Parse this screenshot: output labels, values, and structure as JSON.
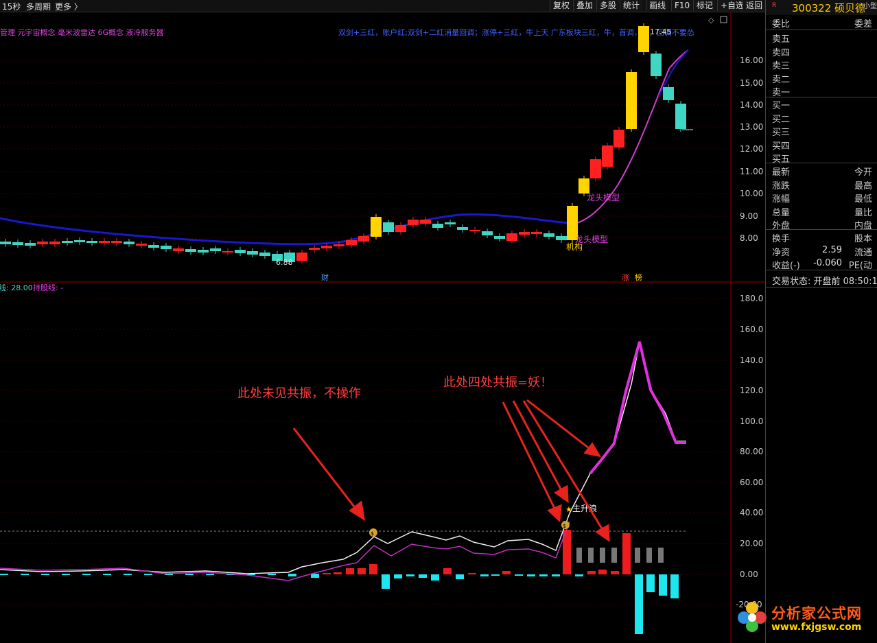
{
  "topbar": {
    "period": "15秒",
    "multi": "多周期",
    "more": "更多 〉",
    "buttons": [
      "复权",
      "叠加",
      "多股",
      "统计",
      "画线",
      "F10",
      "标记",
      "+自选",
      "返回"
    ]
  },
  "concepts": {
    "left": "管理 元宇宙概念 毫米波雷达 6G概念 液冷服务器",
    "right": "双剑+三红，账户红;双剑+二红消量回调；涨停+三红，牛上天 广东板块三红，牛，首调，红，回调不要怂"
  },
  "main_axis": [
    "16.00",
    "15.00",
    "14.00",
    "13.00",
    "12.00",
    "11.00",
    "10.00",
    "9.00",
    "8.00"
  ],
  "sub_axis": [
    "180.0",
    "160.0",
    "140.0",
    "120.0",
    "100.0",
    "80.00",
    "60.00",
    "40.00",
    "20.00",
    "0.00",
    "-20.00"
  ],
  "labels": {
    "high": "17.45",
    "low": "6.88",
    "dragon1": "龙头模型",
    "dragon2": "龙头模型",
    "jigou": "机构",
    "cai": "财",
    "zhang": "涨",
    "bang": "榜",
    "wave": "主升浪",
    "indicator_value": "线: 28.00",
    "indicator_hold": "持股线: -"
  },
  "annotations": {
    "left": "此处未见共振，不操作",
    "right": "此处四处共振=妖！"
  },
  "panel": {
    "code_prefix": "R",
    "stock": "300322 硕贝德",
    "tag": "小型",
    "header_left": "委比",
    "header_right": "委差",
    "sell": [
      "卖五",
      "卖四",
      "卖三",
      "卖二",
      "卖一"
    ],
    "buy": [
      "买一",
      "买二",
      "买三",
      "买四",
      "买五"
    ],
    "stats": [
      {
        "l": "最新",
        "m": "",
        "r": "今开"
      },
      {
        "l": "涨跌",
        "m": "",
        "r": "最高"
      },
      {
        "l": "涨幅",
        "m": "",
        "r": "最低"
      },
      {
        "l": "总量",
        "m": "",
        "r": "量比"
      },
      {
        "l": "外盘",
        "m": "",
        "r": "内盘"
      }
    ],
    "stats2": [
      {
        "l": "换手",
        "m": "",
        "r": "股本"
      },
      {
        "l": "净资",
        "m": "2.59",
        "r": "流通"
      },
      {
        "l": "收益(-)",
        "m": "-0.060",
        "r": "PE(动"
      }
    ],
    "status": "交易状态: 开盘前 08:50:1"
  },
  "logo": {
    "text": "分析家公式网",
    "url": "www.fxjgsw.com"
  },
  "colors": {
    "up": "#ff2020",
    "down": "#3fd6c4",
    "limit": "#ffd400",
    "ma": "#1515c8",
    "ma2": "#e040e0",
    "arrow": "#e8231e"
  }
}
